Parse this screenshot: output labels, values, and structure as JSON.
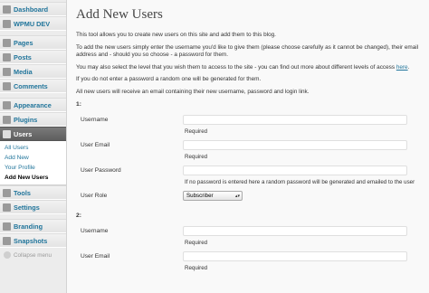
{
  "sidebar": {
    "items": [
      {
        "label": "Dashboard",
        "icon": "dashboard-icon"
      },
      {
        "label": "WPMU DEV",
        "icon": "wpmudev-icon"
      },
      {
        "label": "Pages",
        "icon": "pages-icon"
      },
      {
        "label": "Posts",
        "icon": "posts-icon"
      },
      {
        "label": "Media",
        "icon": "media-icon"
      },
      {
        "label": "Comments",
        "icon": "comments-icon"
      },
      {
        "label": "Appearance",
        "icon": "appearance-icon"
      },
      {
        "label": "Plugins",
        "icon": "plugins-icon"
      },
      {
        "label": "Users",
        "icon": "users-icon"
      },
      {
        "label": "Tools",
        "icon": "tools-icon"
      },
      {
        "label": "Settings",
        "icon": "settings-icon"
      },
      {
        "label": "Branding",
        "icon": "branding-icon"
      },
      {
        "label": "Snapshots",
        "icon": "snapshots-icon"
      }
    ],
    "users_submenu": [
      "All Users",
      "Add New",
      "Your Profile",
      "Add New Users"
    ],
    "collapse_label": "Collapse menu"
  },
  "main": {
    "title": "Add New Users",
    "para1": "This tool allows you to create new users on this site and add them to this blog.",
    "para2": "To add the new users simply enter the username you'd like to give them (please choose carefully as it cannot be changed), their email address and - should you so choose - a password for them.",
    "para3_text": "You may also select the level that you wish them to access to the site - you can find out more about different levels of access ",
    "para3_link": "here",
    "para3_end": ".",
    "para4": "If you do not enter a password a random one will be generated for them.",
    "para5": "All new users will receive an email containing their new username, password and login link.",
    "user1": {
      "number": "1:",
      "username_label": "Username",
      "username_hint": "Required",
      "email_label": "User Email",
      "email_hint": "Required",
      "password_label": "User Password",
      "password_hint": "If no password is entered here a random password will be generated and emailed to the user",
      "role_label": "User Role",
      "role_value": "Subscriber"
    },
    "user2": {
      "number": "2:",
      "username_label": "Username",
      "username_hint": "Required",
      "email_label": "User Email",
      "email_hint": "Required"
    }
  }
}
